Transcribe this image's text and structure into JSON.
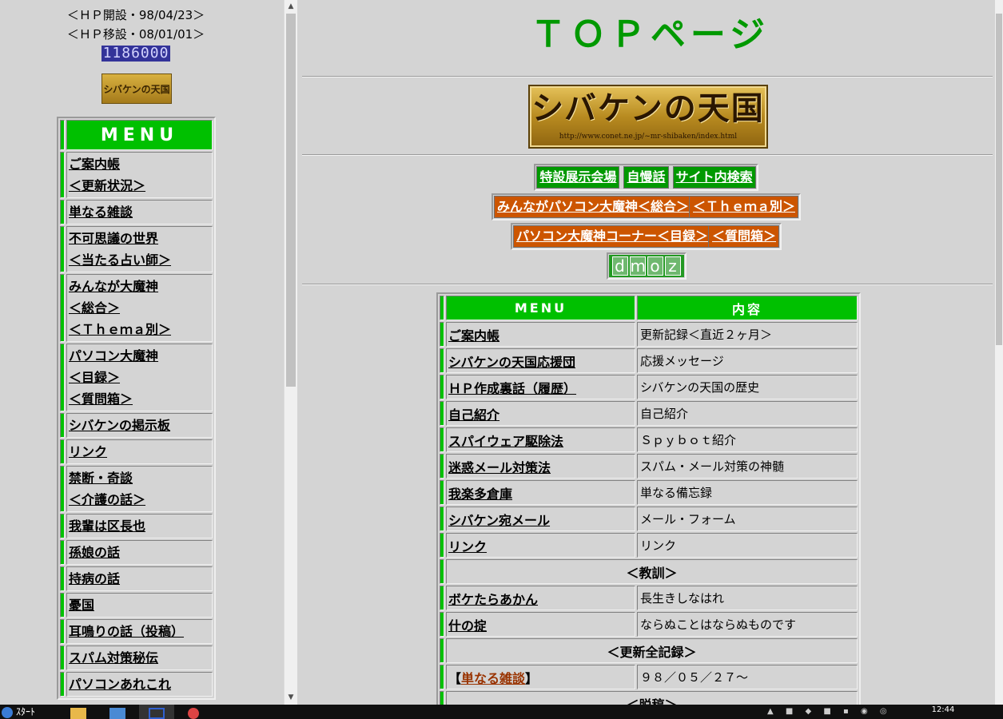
{
  "left": {
    "hp_open": "＜ＨＰ開設・98/04/23＞",
    "hp_move": "＜ＨＰ移設・08/01/01＞",
    "counter": "1186000",
    "small_logo": "シバケンの天国",
    "menu_header": "MENU",
    "menu_items": [
      {
        "lines": [
          "ご案内帳",
          "＜更新状況＞"
        ]
      },
      {
        "lines": [
          "単なる雑談"
        ]
      },
      {
        "lines": [
          "不可思議の世界",
          "＜当たる占い師＞"
        ]
      },
      {
        "lines": [
          "みんなが大魔神",
          "＜総合＞",
          "＜Ｔｈｅｍａ別＞"
        ]
      },
      {
        "lines": [
          "パソコン大魔神",
          "＜目録＞",
          "＜質問箱＞"
        ]
      },
      {
        "lines": [
          "シバケンの掲示板"
        ]
      },
      {
        "lines": [
          "リンク"
        ]
      },
      {
        "lines": [
          "禁断・奇談",
          "＜介護の話＞"
        ]
      },
      {
        "lines": [
          "我輩は区長也"
        ]
      },
      {
        "lines": [
          "孫娘の話"
        ]
      },
      {
        "lines": [
          "持病の話"
        ]
      },
      {
        "lines": [
          "憂国"
        ]
      },
      {
        "lines": [
          "耳鳴りの話（投稿）"
        ]
      },
      {
        "lines": [
          "スパム対策秘伝"
        ]
      },
      {
        "lines": [
          "パソコンあれこれ"
        ]
      }
    ]
  },
  "right": {
    "title": "ＴＯＰページ",
    "logo_text": "シバケンの天国",
    "logo_url": "http://www.conet.ne.jp/~mr-shibaken/index.html",
    "buttons_row1": [
      "特設展示会場",
      "自慢話",
      "サイト内検索"
    ],
    "buttons_row2": [
      "みんながパソコン大魔神＜総合＞",
      "＜Ｔｈｅｍａ別＞"
    ],
    "buttons_row3": [
      "パソコン大魔神コーナー＜目録＞",
      "＜質問箱＞"
    ],
    "dmoz": [
      "d",
      "m",
      "o",
      "z"
    ],
    "table_header": {
      "menu": "MENU",
      "content": "内容"
    },
    "rows": [
      {
        "menu": "ご案内帳",
        "content": "更新記録＜直近２ヶ月＞"
      },
      {
        "menu": "シバケンの天国応援団",
        "content": "応援メッセージ"
      },
      {
        "menu": "ＨＰ作成裏話（履歴）",
        "content": "シバケンの天国の歴史"
      },
      {
        "menu": "自己紹介",
        "content": "自己紹介"
      },
      {
        "menu": "スパイウェア駆除法",
        "content": "Ｓｐｙｂｏｔ紹介"
      },
      {
        "menu": "迷惑メール対策法",
        "content": "スパム・メール対策の神髄"
      },
      {
        "menu": "我楽多倉庫",
        "content": "単なる備忘録"
      },
      {
        "menu": "シバケン宛メール",
        "content": "メール・フォーム"
      },
      {
        "menu": "リンク",
        "content": "リンク"
      }
    ],
    "section_kyokun": "＜教訓＞",
    "kyokun_rows": [
      {
        "menu": "ボケたらあかん",
        "content": "長生きしなはれ"
      },
      {
        "menu": "什の掟",
        "content": "ならぬことはならぬものです"
      }
    ],
    "section_update": "＜更新全記録＞",
    "update_row": {
      "bracket_open": "【",
      "menu": "単なる雑談",
      "bracket_close": "】",
      "content": "９８／０５／２７～"
    },
    "section_dakko": "＜脱稿＞"
  },
  "taskbar": {
    "start_label": "ｽﾀｰﾄ",
    "clock": "12:44"
  }
}
